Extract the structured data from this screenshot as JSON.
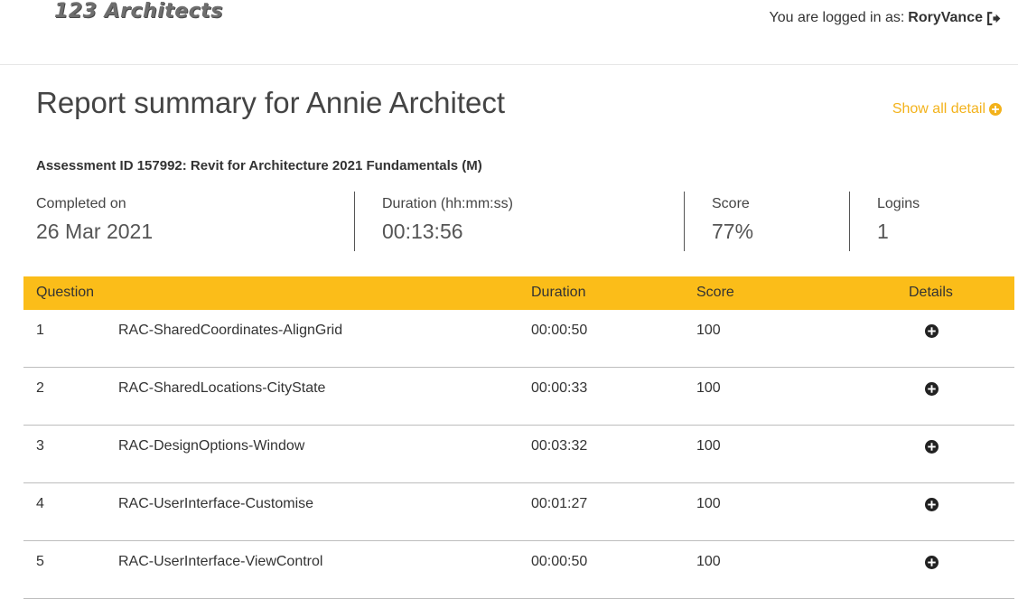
{
  "header": {
    "logo_text": "123 Architects",
    "login_prefix": "You are logged in as:",
    "username": "RoryVance"
  },
  "report": {
    "title": "Report summary for Annie Architect",
    "show_all_label": "Show all detail",
    "assessment_label": "Assessment ID 157992: Revit for Architecture 2021 Fundamentals (M)"
  },
  "stats": {
    "completed_label": "Completed on",
    "completed_value": "26 Mar 2021",
    "duration_label": "Duration (hh:mm:ss)",
    "duration_value": "00:13:56",
    "score_label": "Score",
    "score_value": "77%",
    "logins_label": "Logins",
    "logins_value": "1"
  },
  "table": {
    "headers": {
      "question": "Question",
      "duration": "Duration",
      "score": "Score",
      "details": "Details"
    },
    "rows": [
      {
        "num": "1",
        "name": "RAC-SharedCoordinates-AlignGrid",
        "duration": "00:00:50",
        "score": "100"
      },
      {
        "num": "2",
        "name": "RAC-SharedLocations-CityState",
        "duration": "00:00:33",
        "score": "100"
      },
      {
        "num": "3",
        "name": "RAC-DesignOptions-Window",
        "duration": "00:03:32",
        "score": "100"
      },
      {
        "num": "4",
        "name": "RAC-UserInterface-Customise",
        "duration": "00:01:27",
        "score": "100"
      },
      {
        "num": "5",
        "name": "RAC-UserInterface-ViewControl",
        "duration": "00:00:50",
        "score": "100"
      }
    ]
  },
  "colors": {
    "accent": "#fbbd19",
    "link": "#f3b21b"
  },
  "icons": {
    "logout": "logout-icon",
    "show_all": "plus-circle-icon",
    "detail": "plus-circle-icon"
  }
}
